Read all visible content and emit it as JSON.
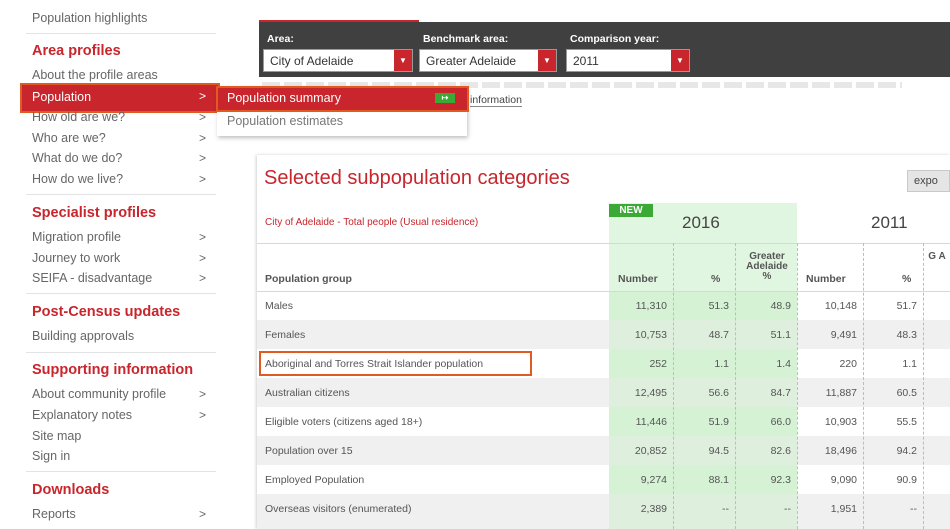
{
  "sidebar": {
    "top_link": "Population highlights",
    "area_profiles": {
      "heading": "Area profiles",
      "items": [
        {
          "label": "About the profile areas"
        },
        {
          "label": "Population",
          "chevron": ">"
        },
        {
          "label": "How old are we?",
          "chevron": ">"
        },
        {
          "label": "Who are we?",
          "chevron": ">"
        },
        {
          "label": "What do we do?",
          "chevron": ">"
        },
        {
          "label": "How do we live?",
          "chevron": ">"
        }
      ]
    },
    "specialist_profiles": {
      "heading": "Specialist profiles",
      "items": [
        {
          "label": "Migration profile",
          "chevron": ">"
        },
        {
          "label": "Journey to work",
          "chevron": ">"
        },
        {
          "label": "SEIFA - disadvantage",
          "chevron": ">"
        }
      ]
    },
    "post_census": {
      "heading": "Post-Census updates",
      "items": [
        {
          "label": "Building approvals"
        }
      ]
    },
    "supporting": {
      "heading": "Supporting information",
      "items": [
        {
          "label": "About community profile",
          "chevron": ">"
        },
        {
          "label": "Explanatory notes",
          "chevron": ">"
        },
        {
          "label": "Site map"
        },
        {
          "label": "Sign in"
        }
      ]
    },
    "downloads": {
      "heading": "Downloads",
      "items": [
        {
          "label": "Reports",
          "chevron": ">"
        }
      ]
    }
  },
  "flyout": {
    "items": [
      {
        "label": "Population summary",
        "icon": "new-icon"
      },
      {
        "label": "Population estimates"
      }
    ]
  },
  "topbar": {
    "area": {
      "label": "Area:",
      "value": "City of Adelaide"
    },
    "benchmark": {
      "label": "Benchmark area:",
      "value": "Greater Adelaide"
    },
    "year": {
      "label": "Comparison year:",
      "value": "2011"
    }
  },
  "info_link": "information",
  "table": {
    "title": "Selected subpopulation categories",
    "export_label": "expo",
    "new_badge": "NEW",
    "total_label": "City of Adelaide - Total people (Usual residence)",
    "years": [
      "2016",
      "2011"
    ],
    "headers": {
      "group": "Population group",
      "number": "Number",
      "percent": "%",
      "benchmark": "Greater Adelaide %",
      "number2": "Number",
      "percent2": "%",
      "partial": "G A"
    },
    "rows": [
      {
        "label": "Males",
        "n16": "11,310",
        "p16": "51.3",
        "b16": "48.9",
        "n11": "10,148",
        "p11": "51.7"
      },
      {
        "label": "Females",
        "n16": "10,753",
        "p16": "48.7",
        "b16": "51.1",
        "n11": "9,491",
        "p11": "48.3"
      },
      {
        "label": "Aboriginal and Torres Strait Islander population",
        "n16": "252",
        "p16": "1.1",
        "b16": "1.4",
        "n11": "220",
        "p11": "1.1"
      },
      {
        "label": "Australian citizens",
        "n16": "12,495",
        "p16": "56.6",
        "b16": "84.7",
        "n11": "11,887",
        "p11": "60.5"
      },
      {
        "label": "Eligible voters (citizens aged 18+)",
        "n16": "11,446",
        "p16": "51.9",
        "b16": "66.0",
        "n11": "10,903",
        "p11": "55.5"
      },
      {
        "label": "Population over 15",
        "n16": "20,852",
        "p16": "94.5",
        "b16": "82.6",
        "n11": "18,496",
        "p11": "94.2"
      },
      {
        "label": "Employed Population",
        "n16": "9,274",
        "p16": "88.1",
        "b16": "92.3",
        "n11": "9,090",
        "p11": "90.9"
      },
      {
        "label": "Overseas visitors (enumerated)",
        "n16": "2,389",
        "p16": "--",
        "b16": "--",
        "n11": "1,951",
        "p11": "--"
      }
    ]
  },
  "colors": {
    "accent": "#c8252c",
    "highlight": "#e15a22",
    "new_green": "#3aa935",
    "bar": "#404040"
  }
}
